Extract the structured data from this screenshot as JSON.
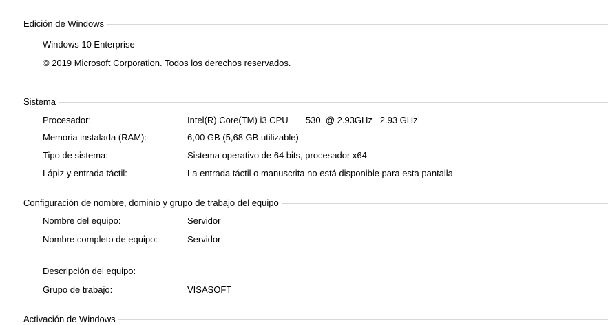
{
  "sections": {
    "edition": {
      "title": "Edición de Windows",
      "product": "Windows 10 Enterprise",
      "copyright": "© 2019 Microsoft Corporation. Todos los derechos reservados."
    },
    "system": {
      "title": "Sistema",
      "rows": [
        {
          "label": "Procesador:",
          "value": "Intel(R) Core(TM) i3 CPU       530  @ 2.93GHz   2.93 GHz"
        },
        {
          "label": "Memoria instalada (RAM):",
          "value": "6,00 GB (5,68 GB utilizable)"
        },
        {
          "label": "Tipo de sistema:",
          "value": "Sistema operativo de 64 bits, procesador x64"
        },
        {
          "label": "Lápiz y entrada táctil:",
          "value": "La entrada táctil o manuscrita no está disponible para esta pantalla"
        }
      ]
    },
    "computer": {
      "title": "Configuración de nombre, dominio y grupo de trabajo del equipo",
      "rows": [
        {
          "label": "Nombre del equipo:",
          "value": "Servidor"
        },
        {
          "label": "Nombre completo de equipo:",
          "value": "Servidor"
        },
        {
          "label": "Descripción del equipo:",
          "value": ""
        },
        {
          "label": "Grupo de trabajo:",
          "value": "VISASOFT"
        }
      ]
    },
    "activation": {
      "title": "Activación de Windows"
    }
  }
}
